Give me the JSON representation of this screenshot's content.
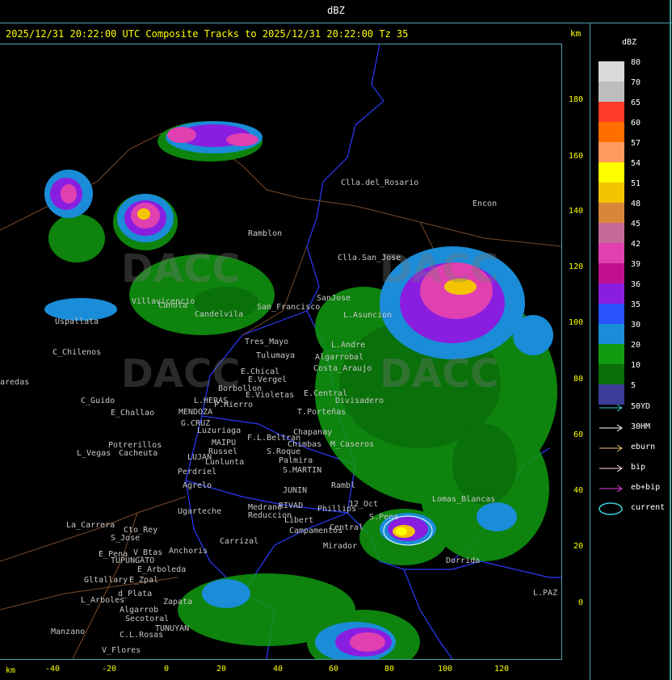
{
  "window": {
    "title": "dBZ"
  },
  "header": {
    "title": "2025/12/31 20:22:00 UTC Composite Tracks to 2025/12/31 20:22:00 Tz 35",
    "km_label": "km"
  },
  "axes": {
    "km_label": "km",
    "y_ticks": [
      "180",
      "160",
      "140",
      "120",
      "100",
      "80",
      "60",
      "40",
      "20",
      "0"
    ],
    "x_ticks": [
      "-40",
      "-20",
      "0",
      "20",
      "40",
      "60",
      "80",
      "100",
      "120"
    ]
  },
  "legend": {
    "title": "dBZ",
    "levels": [
      {
        "label": "80",
        "color": "#d9d9d9"
      },
      {
        "label": "70",
        "color": "#bdbdbd"
      },
      {
        "label": "65",
        "color": "#ff3b2a"
      },
      {
        "label": "60",
        "color": "#ff6f00"
      },
      {
        "label": "57",
        "color": "#ff9a5c"
      },
      {
        "label": "54",
        "color": "#ffff00"
      },
      {
        "label": "51",
        "color": "#f5c400"
      },
      {
        "label": "48",
        "color": "#d8863a"
      },
      {
        "label": "45",
        "color": "#c46a9a"
      },
      {
        "label": "42",
        "color": "#e040b0"
      },
      {
        "label": "39",
        "color": "#c0108e"
      },
      {
        "label": "36",
        "color": "#8a1ee0"
      },
      {
        "label": "35",
        "color": "#2a52ff"
      },
      {
        "label": "30",
        "color": "#1a8cd8"
      },
      {
        "label": "20",
        "color": "#119b11"
      },
      {
        "label": "10",
        "color": "#0a6e0a"
      },
      {
        "label": "5",
        "color": "#3d3d99"
      }
    ],
    "tracks": [
      {
        "label": "50YD",
        "color": "#39d0d8"
      },
      {
        "label": "30HM",
        "color": "#ffffff"
      },
      {
        "label": "eburn",
        "color": "#f0c080"
      },
      {
        "label": "bip",
        "color": "#ffd8f0"
      },
      {
        "label": "eb+bip",
        "color": "#e040e0"
      },
      {
        "label": "current",
        "color": "#39d0d8"
      }
    ]
  },
  "watermark": {
    "text": "DACC"
  },
  "places": [
    {
      "name": "Clla.del_Rosario"
    },
    {
      "name": "Encon"
    },
    {
      "name": "Ramblon"
    },
    {
      "name": "Clla.San_Jose"
    },
    {
      "name": "Villavicencio"
    },
    {
      "name": "Uspallata"
    },
    {
      "name": "Canota"
    },
    {
      "name": "Candelvila"
    },
    {
      "name": "San_Francisco"
    },
    {
      "name": "SanJose"
    },
    {
      "name": "L.Asuncion"
    },
    {
      "name": "Tres_Mayo"
    },
    {
      "name": "Tulumaya"
    },
    {
      "name": "E.Chical"
    },
    {
      "name": "E.Vergel"
    },
    {
      "name": "Borbollon"
    },
    {
      "name": "E.Violetas"
    },
    {
      "name": "P.Hierro"
    },
    {
      "name": "L.HERAS"
    },
    {
      "name": "MENDOZA"
    },
    {
      "name": "G.CRUZ"
    },
    {
      "name": "Luzuriaga"
    },
    {
      "name": "MAIPU"
    },
    {
      "name": "Russel"
    },
    {
      "name": "LUJAN"
    },
    {
      "name": "Lunlunta"
    },
    {
      "name": "Perdriel"
    },
    {
      "name": "Agrelo"
    },
    {
      "name": "Ugarteche"
    },
    {
      "name": "C_Chilenos"
    },
    {
      "name": "C_Guido"
    },
    {
      "name": "E_Challao"
    },
    {
      "name": "Potrerillos"
    },
    {
      "name": "L_Vegas"
    },
    {
      "name": "Cacheuta"
    },
    {
      "name": "La_Carrera"
    },
    {
      "name": "Cto_Rey"
    },
    {
      "name": "S_Jose"
    },
    {
      "name": "E_Pena"
    },
    {
      "name": "V_Btas"
    },
    {
      "name": "TUPUNGATO"
    },
    {
      "name": "Anchoris"
    },
    {
      "name": "E_Arboleda"
    },
    {
      "name": "Gltallary"
    },
    {
      "name": "E_Zpal"
    },
    {
      "name": "L_Arboles"
    },
    {
      "name": "d_Plata"
    },
    {
      "name": "Zapata"
    },
    {
      "name": "Algarrob"
    },
    {
      "name": "Secotoral"
    },
    {
      "name": "TUNUYAN"
    },
    {
      "name": "Manzano"
    },
    {
      "name": "C.L.Rosas"
    },
    {
      "name": "V_Flores"
    },
    {
      "name": "Carrizal"
    },
    {
      "name": "Medrano"
    },
    {
      "name": "Reduccion"
    },
    {
      "name": "RIVAD"
    },
    {
      "name": "Phillips"
    },
    {
      "name": "Libert"
    },
    {
      "name": "Campamentos"
    },
    {
      "name": "Central"
    },
    {
      "name": "Mirador"
    },
    {
      "name": "12_Oct"
    },
    {
      "name": "S.Pena"
    },
    {
      "name": "Lomas_Blancas"
    },
    {
      "name": "Dorrida"
    },
    {
      "name": "L.PAZ"
    },
    {
      "name": "S.MARTIN"
    },
    {
      "name": "JUNIN"
    },
    {
      "name": "Palmira"
    },
    {
      "name": "Rambl"
    },
    {
      "name": "Chapanay"
    },
    {
      "name": "Chimbas"
    },
    {
      "name": "M_Caseros"
    },
    {
      "name": "F.L.Beltran"
    },
    {
      "name": "S.Roque"
    },
    {
      "name": "T.Porteñas"
    },
    {
      "name": "E.Central"
    },
    {
      "name": "Divisadero"
    },
    {
      "name": "L.Andre"
    },
    {
      "name": "Costa_Araujo"
    },
    {
      "name": "Algarrobal"
    },
    {
      "name": "aredas"
    }
  ]
}
